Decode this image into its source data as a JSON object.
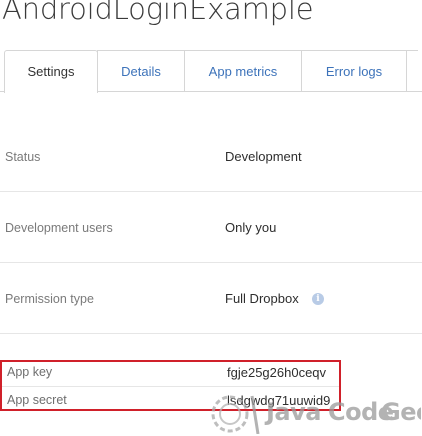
{
  "app": {
    "title": "AndroidLoginExample"
  },
  "tabs": [
    {
      "label": "Settings",
      "active": true
    },
    {
      "label": "Details",
      "active": false
    },
    {
      "label": "App metrics",
      "active": false
    },
    {
      "label": "Error logs",
      "active": false
    }
  ],
  "settings": {
    "status": {
      "label": "Status",
      "value": "Development"
    },
    "development_users": {
      "label": "Development users",
      "value": "Only you"
    },
    "permission_type": {
      "label": "Permission type",
      "value": "Full Dropbox",
      "icon": "info-icon"
    },
    "app_key": {
      "label": "App key",
      "value": "fgje25g26h0ceqv"
    },
    "app_secret": {
      "label": "App secret",
      "value": "lsdgwdg71uuwid9"
    }
  },
  "watermark": {
    "part1": "Java",
    "part2": "Code",
    "part3": "Geeks"
  },
  "colors": {
    "link": "#3d73ba",
    "highlight_border": "#d0202a",
    "info_icon": "#b8cbe6",
    "watermark": "#9a9a9a"
  }
}
